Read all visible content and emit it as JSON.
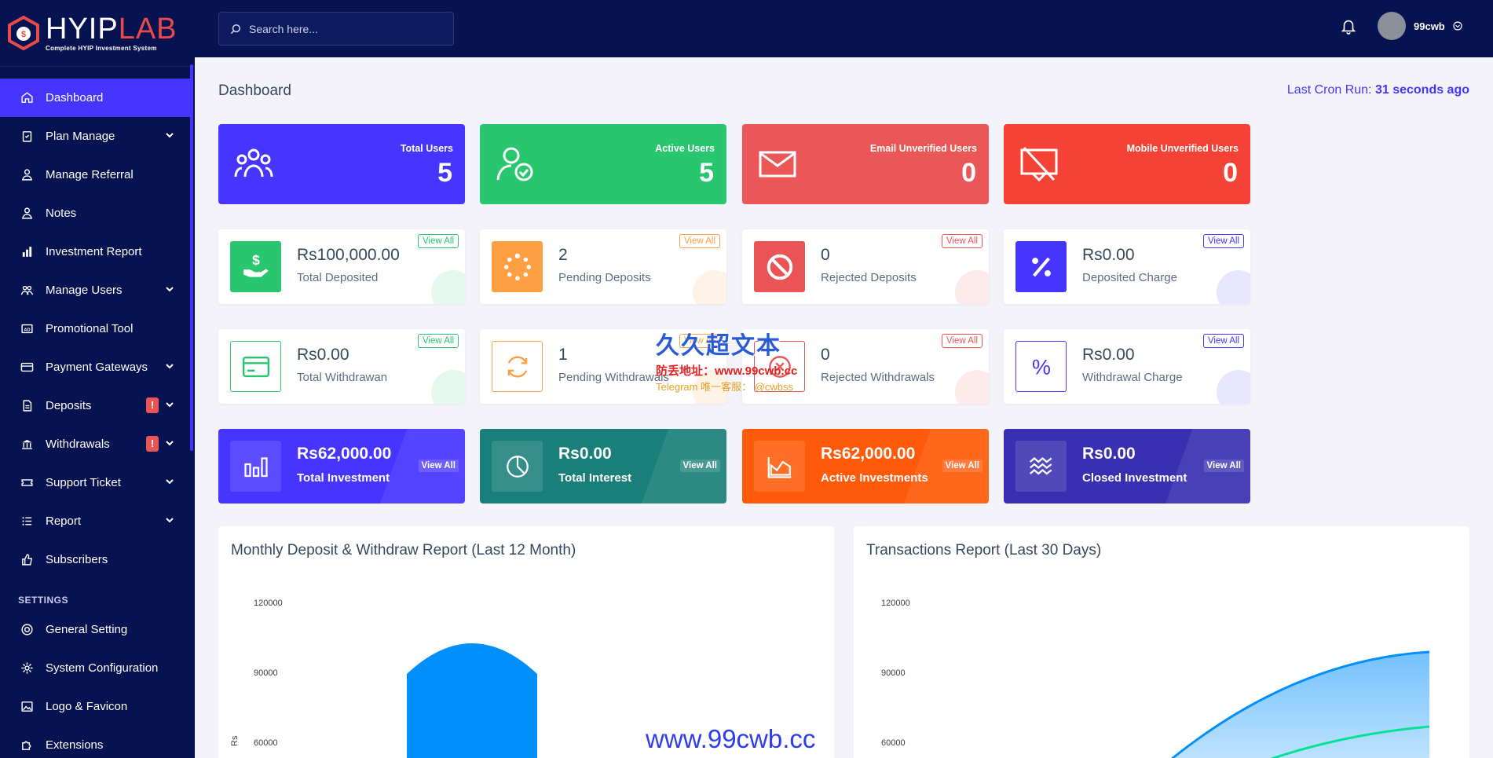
{
  "brand": {
    "name_part1": "HYIP",
    "name_part2": "LAB",
    "tagline": "Complete HYIP Investment System"
  },
  "search": {
    "placeholder": "Search here..."
  },
  "user": {
    "name": "99cwb"
  },
  "sidebar": {
    "items": [
      {
        "label": "Dashboard",
        "icon": "home-icon",
        "active": true
      },
      {
        "label": "Plan Manage",
        "icon": "clipboard-icon",
        "dropdown": true
      },
      {
        "label": "Manage Referral",
        "icon": "user-tie-icon"
      },
      {
        "label": "Notes",
        "icon": "user-tie-icon"
      },
      {
        "label": "Investment Report",
        "icon": "bar-chart-icon"
      },
      {
        "label": "Manage Users",
        "icon": "users-icon",
        "dropdown": true
      },
      {
        "label": "Promotional Tool",
        "icon": "ad-icon"
      },
      {
        "label": "Payment Gateways",
        "icon": "credit-card-icon",
        "dropdown": true
      },
      {
        "label": "Deposits",
        "icon": "file-invoice-icon",
        "dropdown": true,
        "alert": "!"
      },
      {
        "label": "Withdrawals",
        "icon": "bank-icon",
        "dropdown": true,
        "alert": "!"
      },
      {
        "label": "Support Ticket",
        "icon": "ticket-icon",
        "dropdown": true
      },
      {
        "label": "Report",
        "icon": "list-icon",
        "dropdown": true
      },
      {
        "label": "Subscribers",
        "icon": "thumbs-up-icon"
      }
    ],
    "settings_heading": "SETTINGS",
    "settings_items": [
      {
        "label": "General Setting",
        "icon": "life-ring-icon"
      },
      {
        "label": "System Configuration",
        "icon": "gear-icon"
      },
      {
        "label": "Logo & Favicon",
        "icon": "image-icon"
      },
      {
        "label": "Extensions",
        "icon": "puzzle-icon"
      }
    ]
  },
  "page": {
    "title": "Dashboard",
    "cron_label": "Last Cron Run:",
    "cron_value": "31 seconds ago"
  },
  "top_widgets": [
    {
      "label": "Total Users",
      "value": "5",
      "color": "#4634ff",
      "icon": "users-group-icon"
    },
    {
      "label": "Active Users",
      "value": "5",
      "color": "#28c76f",
      "icon": "user-check-icon"
    },
    {
      "label": "Email Unverified Users",
      "value": "0",
      "color": "#eb5757",
      "icon": "envelope-icon"
    },
    {
      "label": "Mobile Unverified Users",
      "value": "0",
      "color": "#f44336",
      "icon": "mobile-slash-icon"
    }
  ],
  "deposit_widgets": [
    {
      "amount": "Rs100,000.00",
      "label": "Total Deposited",
      "view": "View All",
      "color": "#28c76f",
      "icon": "hand-dollar-icon"
    },
    {
      "amount": "2",
      "label": "Pending Deposits",
      "view": "View All",
      "color": "#ff9f43",
      "icon": "spinner-icon"
    },
    {
      "amount": "0",
      "label": "Rejected Deposits",
      "view": "View All",
      "color": "#ea5455",
      "icon": "ban-icon"
    },
    {
      "amount": "Rs0.00",
      "label": "Deposited Charge",
      "view": "View All",
      "color": "#4634ff",
      "icon": "percent-icon"
    }
  ],
  "withdraw_widgets": [
    {
      "amount": "Rs0.00",
      "label": "Total Withdrawan",
      "view": "View All",
      "color": "#28c76f",
      "icon": "credit-card-icon"
    },
    {
      "amount": "1",
      "label": "Pending Withdrawals",
      "view": "View All",
      "color": "#ff9f43",
      "icon": "sync-icon"
    },
    {
      "amount": "0",
      "label": "Rejected Withdrawals",
      "view": "View All",
      "color": "#ea5455",
      "icon": "times-circle-icon"
    },
    {
      "amount": "Rs0.00",
      "label": "Withdrawal Charge",
      "view": "View All",
      "color": "#4634ff",
      "icon": "percent-icon"
    }
  ],
  "invest_widgets": [
    {
      "amount": "Rs62,000.00",
      "label": "Total Investment",
      "view": "View All",
      "color": "#4634ff",
      "icon": "chart-bar-icon"
    },
    {
      "amount": "Rs0.00",
      "label": "Total Interest",
      "view": "View All",
      "color": "#1a7f7a",
      "icon": "pie-chart-icon"
    },
    {
      "amount": "Rs62,000.00",
      "label": "Active Investments",
      "view": "View All",
      "color": "#ff5a0a",
      "icon": "chart-area-icon"
    },
    {
      "amount": "Rs0.00",
      "label": "Closed Investment",
      "view": "View All",
      "color": "#3a2fb0",
      "icon": "wave-icon"
    }
  ],
  "charts": {
    "left_title": "Monthly Deposit & Withdraw Report (Last 12 Month)",
    "right_title": "Transactions Report (Last 30 Days)"
  },
  "chart_data": [
    {
      "type": "bar",
      "title": "Monthly Deposit & Withdraw Report (Last 12 Month)",
      "ylabel": "Rs",
      "yticks": [
        120000,
        90000,
        60000
      ],
      "series": [
        {
          "values": [
            100000
          ]
        }
      ]
    },
    {
      "type": "area",
      "title": "Transactions Report (Last 30 Days)",
      "yticks": [
        120000,
        90000,
        60000
      ],
      "series": [
        {
          "values": [
            100000
          ]
        }
      ]
    }
  ],
  "overlay": {
    "wm_title": "久久超文本",
    "wm_line2": "防丢地址：www.99cwb.cc",
    "wm_line3": "Telegram 唯一客服： @cwbss",
    "url": "www.99cwb.cc"
  }
}
